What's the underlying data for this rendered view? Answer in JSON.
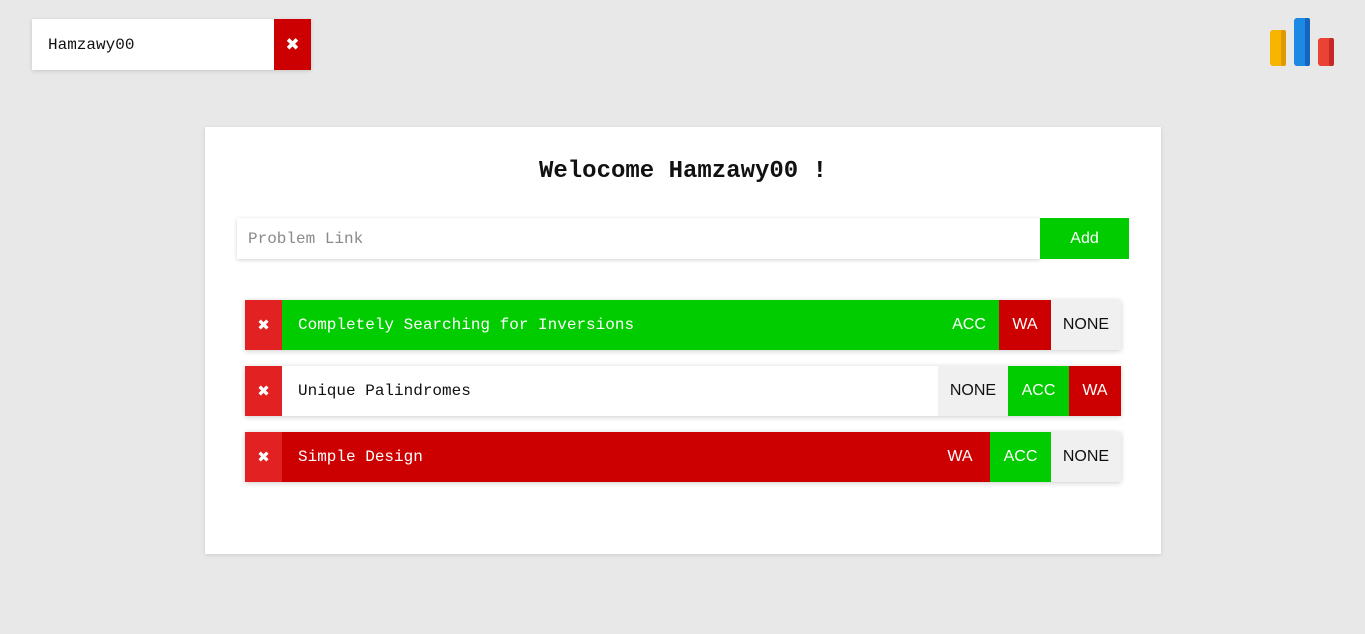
{
  "user": {
    "name": "Hamzawy00",
    "logout_icon": "✖"
  },
  "logo": {
    "icon": "bar-chart-logo",
    "colors": [
      "#f7b500",
      "#1e88e5",
      "#e53935"
    ]
  },
  "main": {
    "title": "Welocome Hamzawy00 !",
    "input_placeholder": "Problem Link",
    "input_value": "",
    "add_label": "Add"
  },
  "colors": {
    "acc": "#00cc00",
    "wa": "#cc0000",
    "none": "#f0f0f0",
    "delete": "#e22222"
  },
  "problems": [
    {
      "title": "Completely Searching for Inversions",
      "state": "ACC",
      "delete_icon": "✖",
      "buttons": [
        "ACC",
        "WA",
        "NONE"
      ]
    },
    {
      "title": "Unique Palindromes",
      "state": "NONE",
      "delete_icon": "✖",
      "buttons": [
        "NONE",
        "ACC",
        "WA"
      ]
    },
    {
      "title": "Simple Design",
      "state": "WA",
      "delete_icon": "✖",
      "buttons": [
        "WA",
        "ACC",
        "NONE"
      ]
    }
  ]
}
